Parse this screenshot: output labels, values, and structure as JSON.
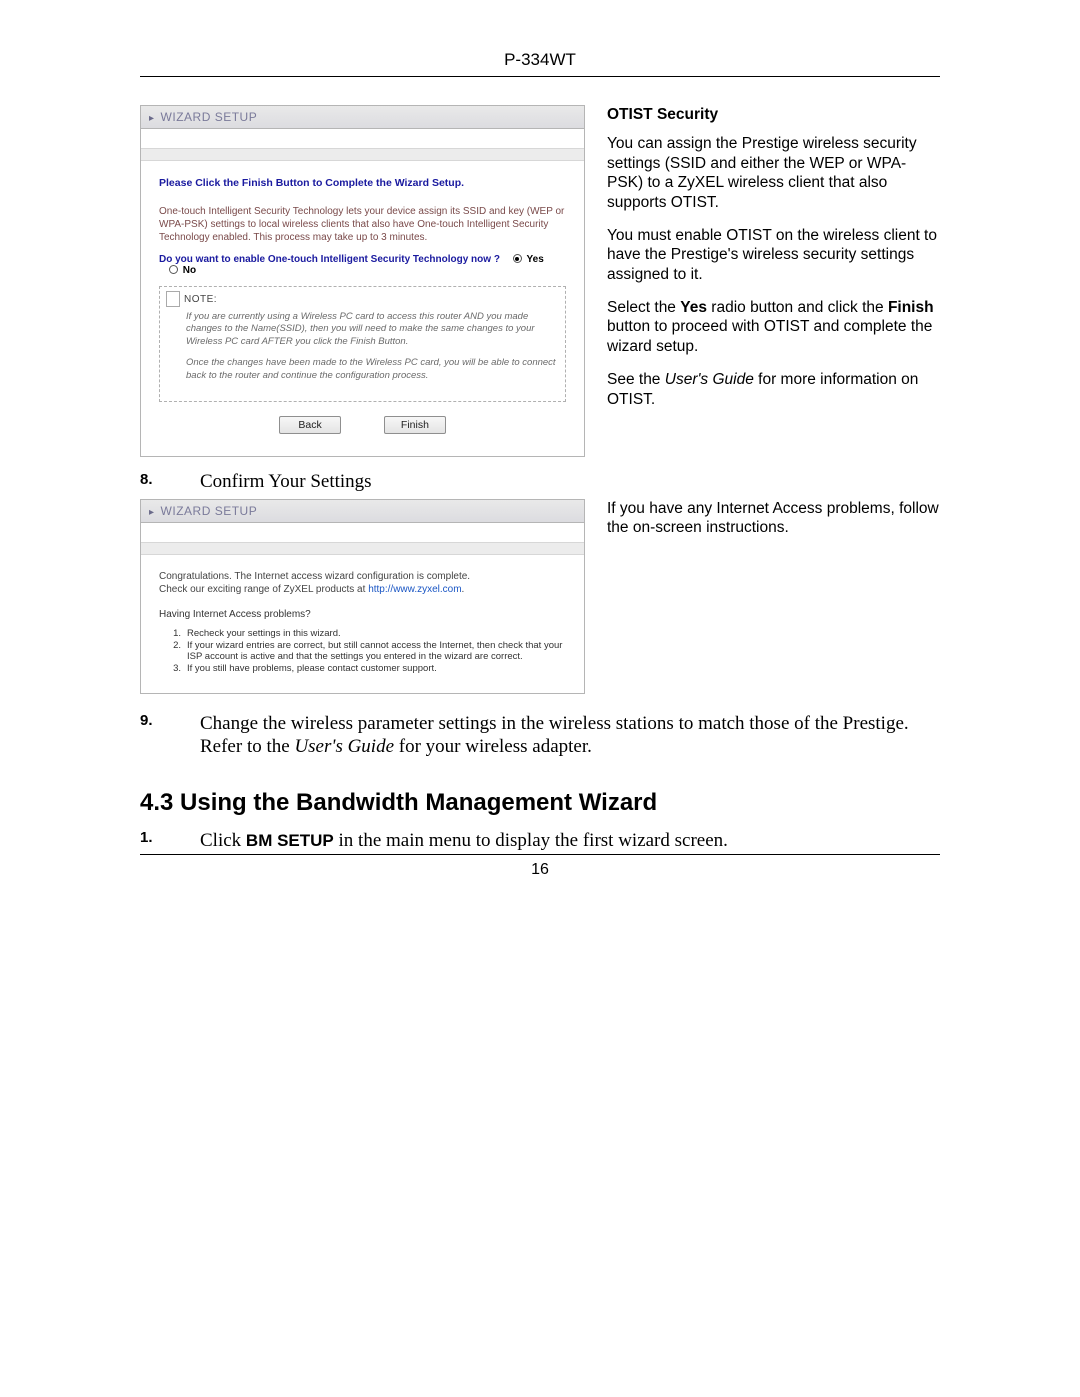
{
  "header": {
    "model": "P-334WT"
  },
  "otist": {
    "heading": "OTIST Security",
    "p1": "You can assign the Prestige wireless security settings (SSID and either the WEP or WPA-PSK) to a ZyXEL wireless client that also supports OTIST.",
    "p2": "You must enable OTIST on the wireless client to have the Prestige's wireless security settings assigned to it.",
    "p3_pre": "Select the ",
    "p3_yes": "Yes",
    "p3_mid": " radio button and click the ",
    "p3_finish": "Finish",
    "p3_post": " button to proceed with OTIST and complete the wizard setup.",
    "p4_pre": "See the ",
    "p4_ital": "User's Guide",
    "p4_post": " for more information on OTIST."
  },
  "wizard1": {
    "title": "WIZARD SETUP",
    "headline": "Please Click the Finish Button to Complete the Wizard Setup.",
    "desc": "One-touch Intelligent Security Technology lets your device assign its SSID and key (WEP or WPA-PSK) settings to local wireless clients that also have One-touch Intelligent Security Technology enabled. This process may take up to 3 minutes.",
    "question": "Do you want to enable One-touch Intelligent Security Technology now ?",
    "opt_yes": "Yes",
    "opt_no": "No",
    "note_label": "NOTE:",
    "note1": "If you are currently using a Wireless PC card to access this router AND you made changes to the Name(SSID), then you will need to make the same changes to your Wireless PC card AFTER you click the Finish Button.",
    "note2": "Once the changes have been made to the Wireless PC card, you will be able to connect back to the router and continue the configuration process.",
    "back": "Back",
    "finish": "Finish"
  },
  "step8": {
    "num": "8.",
    "title": "Confirm Your Settings"
  },
  "confirm_side": {
    "p": "If you have any Internet Access problems, follow the on-screen instructions."
  },
  "wizard2": {
    "title": "WIZARD SETUP",
    "line1": "Congratulations. The Internet access wizard configuration is complete.",
    "line2_pre": "Check our exciting range of ZyXEL products at ",
    "line2_link": "http://www.zyxel.com",
    "line2_post": ".",
    "problems": "Having Internet Access problems?",
    "li1": "Recheck your settings in this wizard.",
    "li2": "If your wizard entries are correct, but still cannot access the Internet, then check that your ISP account is active and that the settings you entered in the wizard are correct.",
    "li3": "If you still have problems, please contact customer support."
  },
  "step9": {
    "num": "9.",
    "pre": "Change the wireless parameter settings in the wireless stations to match those of the Prestige. Refer to the ",
    "ital": "User's Guide",
    "post": " for your wireless adapter."
  },
  "section43": {
    "title": "4.3 Using the Bandwidth Management Wizard"
  },
  "step43_1": {
    "num": "1.",
    "pre": "Click ",
    "bold": "BM SETUP",
    "post": " in the main menu to display the first wizard screen."
  },
  "footer": {
    "page": "16"
  }
}
